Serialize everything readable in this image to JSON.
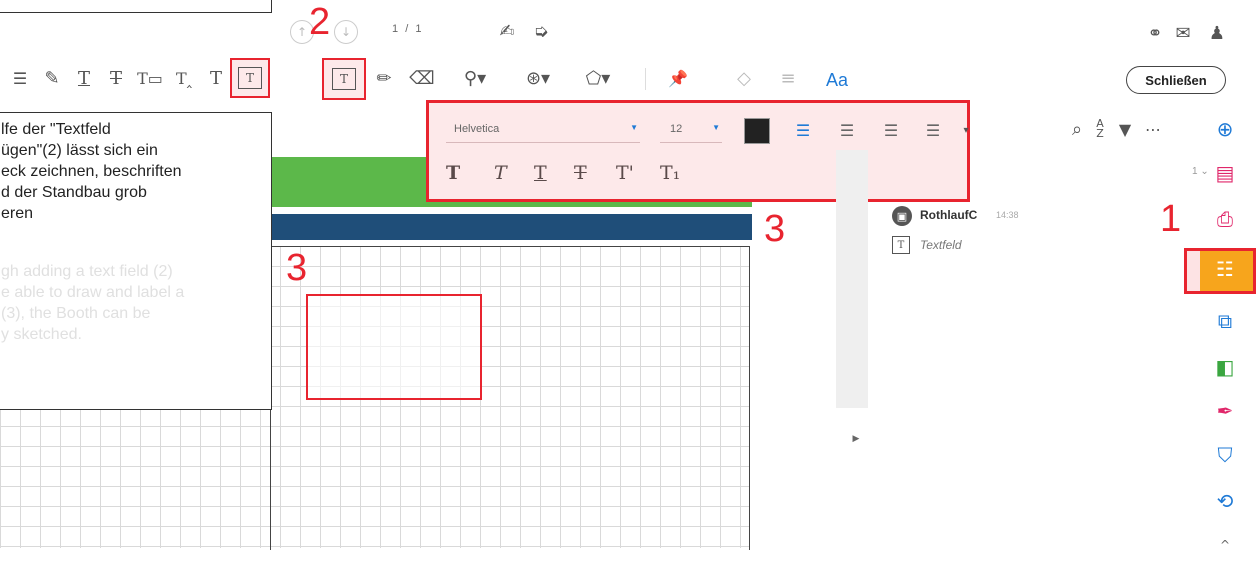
{
  "topbar": {
    "page_current": "1",
    "page_sep": "/",
    "page_total": "1"
  },
  "toolbar": {
    "font_button_label": "Aa",
    "close_button_label": "Schließen"
  },
  "format_panel": {
    "font_name": "Helvetica",
    "font_size": "12",
    "style_labels": {
      "plain": "T",
      "italic": "T",
      "underline": "T",
      "strike": "T",
      "superscript": "T'",
      "subscript": "T₁"
    }
  },
  "callout": {
    "german_lines": [
      "lfe der \"Textfeld",
      "ügen\"(2) lässt sich ein",
      "eck zeichnen, beschriften",
      "d der Standbau grob",
      "eren"
    ],
    "english_lines": [
      "gh adding a text field (2)",
      "e able to draw and label a",
      "(3), the Booth can be",
      "y sketched."
    ]
  },
  "comments": {
    "author": "RothlaufC",
    "time": "14:38",
    "item_label": "Textfeld",
    "page_count": "1"
  },
  "markers": {
    "one": "1",
    "two": "2",
    "three_a": "3",
    "three_b": "3"
  },
  "colors": {
    "green_band": "#5cb84a",
    "navy_band": "#1f4e79",
    "annotation_red": "#e8242f",
    "comment_tab_orange": "#f7a51c",
    "right_icon_blue": "#1f7ad6"
  }
}
